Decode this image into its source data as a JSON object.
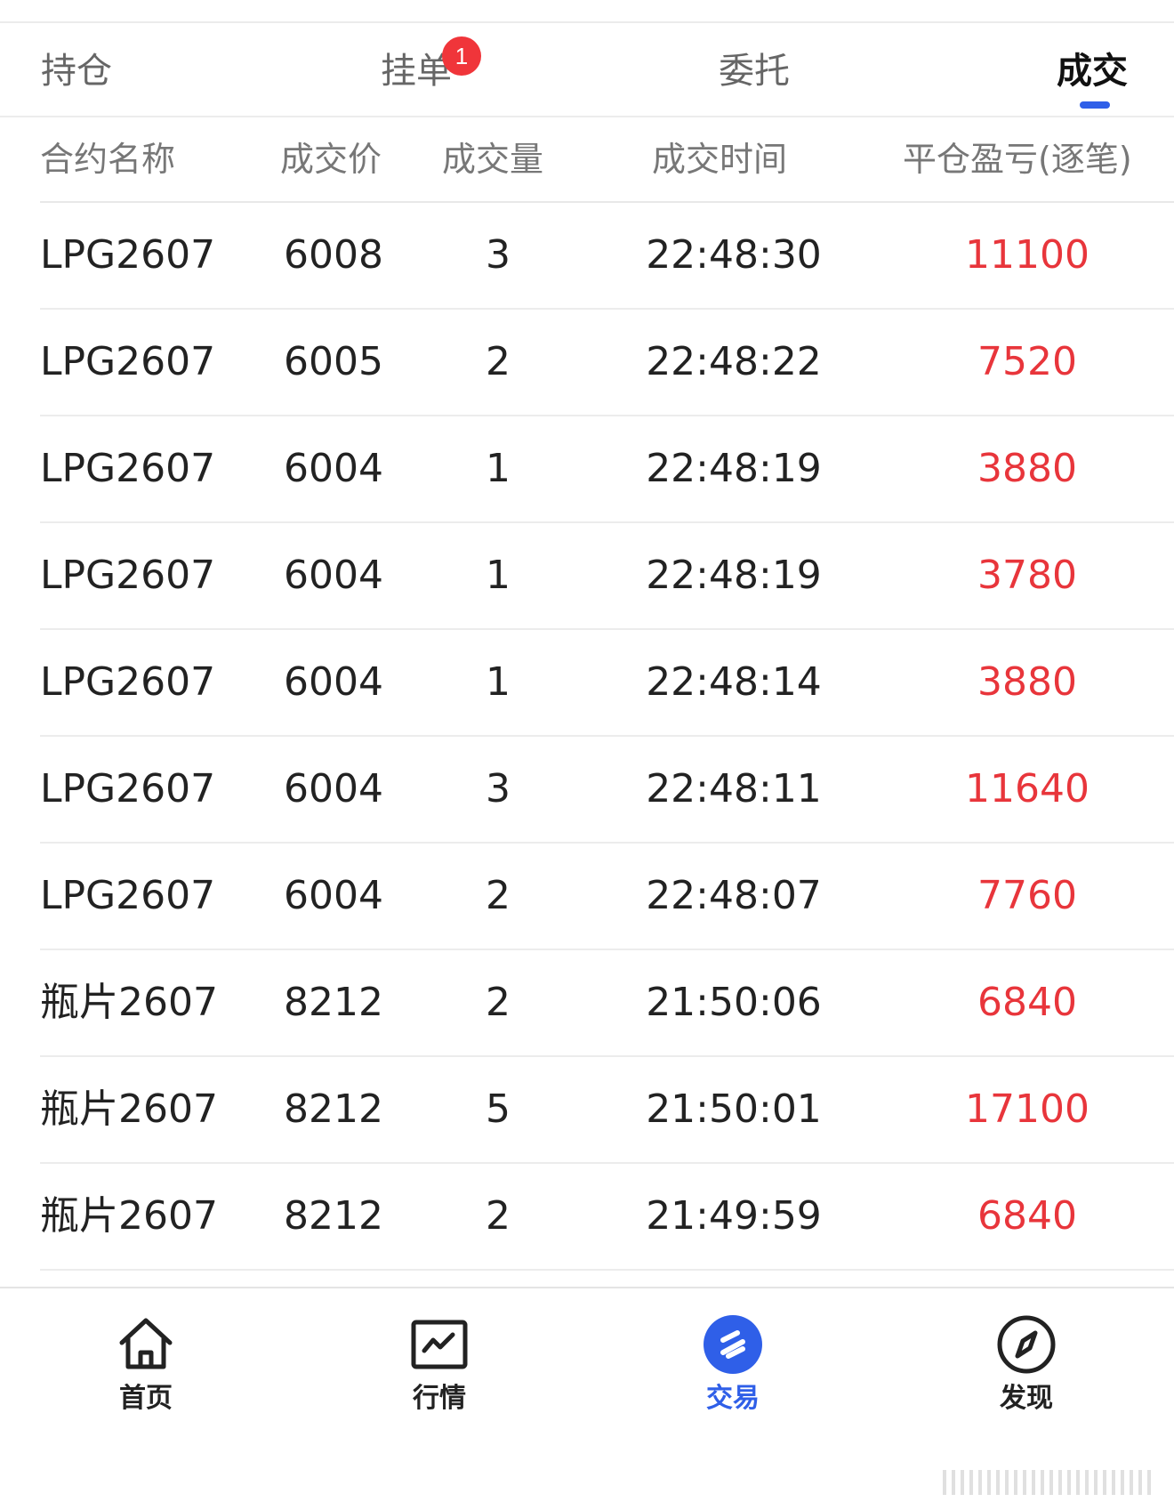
{
  "tabs": [
    {
      "label": "持仓",
      "active": false
    },
    {
      "label": "挂单",
      "active": false,
      "badge": "1"
    },
    {
      "label": "委托",
      "active": false
    },
    {
      "label": "成交",
      "active": true
    }
  ],
  "table": {
    "headers": [
      "合约名称",
      "成交价",
      "成交量",
      "成交时间",
      "平仓盈亏(逐笔)"
    ],
    "rows": [
      {
        "name": "LPG2607",
        "price": "6008",
        "qty": "3",
        "time": "22:48:30",
        "pnl": "11100"
      },
      {
        "name": "LPG2607",
        "price": "6005",
        "qty": "2",
        "time": "22:48:22",
        "pnl": "7520"
      },
      {
        "name": "LPG2607",
        "price": "6004",
        "qty": "1",
        "time": "22:48:19",
        "pnl": "3880"
      },
      {
        "name": "LPG2607",
        "price": "6004",
        "qty": "1",
        "time": "22:48:19",
        "pnl": "3780"
      },
      {
        "name": "LPG2607",
        "price": "6004",
        "qty": "1",
        "time": "22:48:14",
        "pnl": "3880"
      },
      {
        "name": "LPG2607",
        "price": "6004",
        "qty": "3",
        "time": "22:48:11",
        "pnl": "11640"
      },
      {
        "name": "LPG2607",
        "price": "6004",
        "qty": "2",
        "time": "22:48:07",
        "pnl": "7760"
      },
      {
        "name": "瓶片2607",
        "price": "8212",
        "qty": "2",
        "time": "21:50:06",
        "pnl": "6840"
      },
      {
        "name": "瓶片2607",
        "price": "8212",
        "qty": "5",
        "time": "21:50:01",
        "pnl": "17100"
      },
      {
        "name": "瓶片2607",
        "price": "8212",
        "qty": "2",
        "time": "21:49:59",
        "pnl": "6840"
      }
    ]
  },
  "bottom_nav": [
    {
      "label": "首页",
      "icon": "home-icon",
      "active": false
    },
    {
      "label": "行情",
      "icon": "chart-icon",
      "active": false
    },
    {
      "label": "交易",
      "icon": "trade-icon",
      "active": true
    },
    {
      "label": "发现",
      "icon": "compass-icon",
      "active": false
    }
  ],
  "colors": {
    "accent": "#2f5fe8",
    "profit": "#e8353b",
    "badge": "#f0353a"
  }
}
